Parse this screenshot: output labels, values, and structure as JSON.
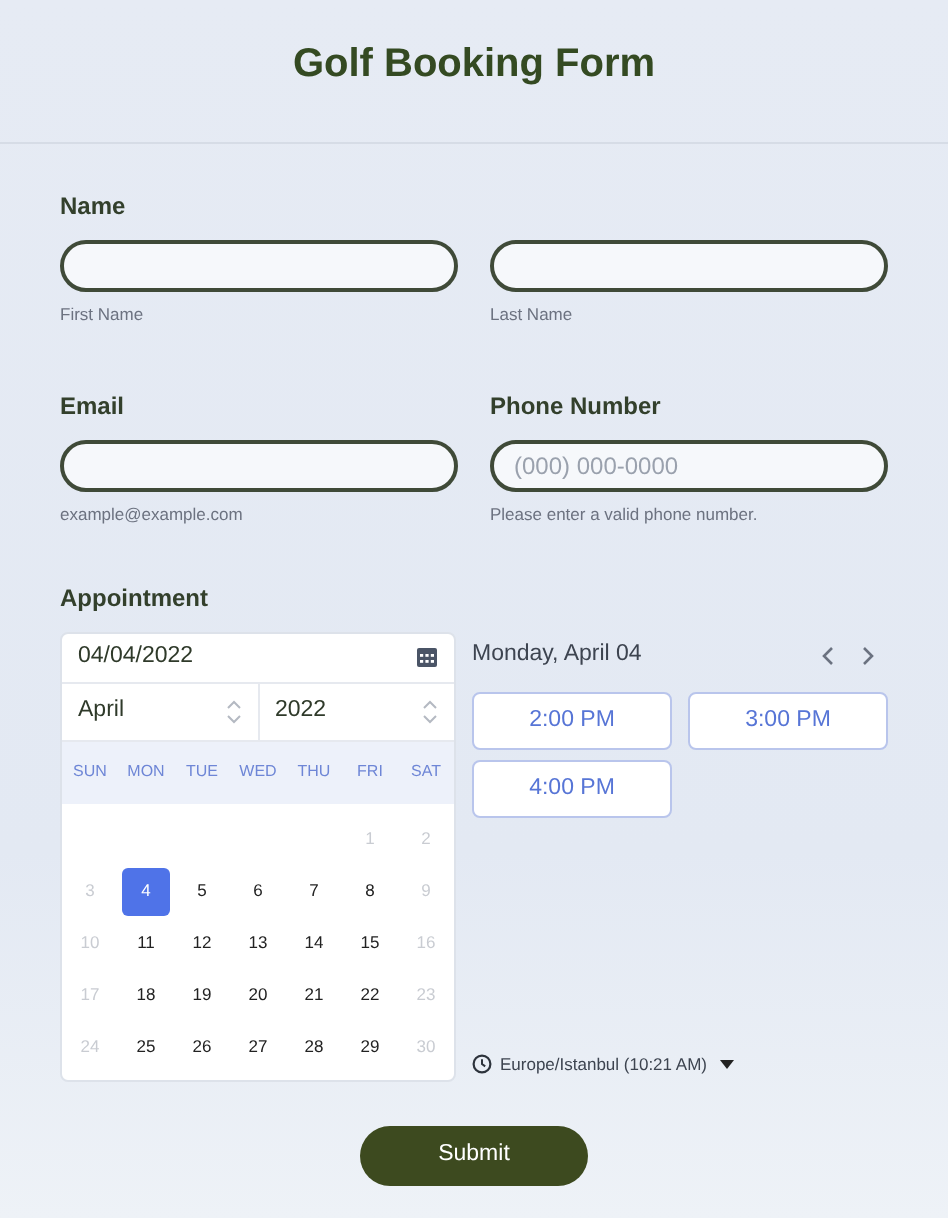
{
  "title": "Golf Booking Form",
  "name": {
    "label": "Name",
    "fields": [
      {
        "sublabel": "First Name"
      },
      {
        "sublabel": "Last Name"
      }
    ]
  },
  "email": {
    "label": "Email",
    "sublabel": "example@example.com"
  },
  "phone": {
    "label": "Phone Number",
    "placeholder": "(000) 000-0000",
    "sublabel": "Please enter a valid phone number."
  },
  "appointment": {
    "label": "Appointment",
    "date_value": "04/04/2022",
    "month": "April",
    "year": "2022",
    "weekdays": [
      "SUN",
      "MON",
      "TUE",
      "WED",
      "THU",
      "FRI",
      "SAT"
    ],
    "weeks": [
      [
        {
          "label": "1",
          "available": false,
          "selected": false
        },
        {
          "label": "2",
          "available": false,
          "selected": false
        }
      ],
      [
        {
          "label": "3",
          "available": false,
          "selected": false
        },
        {
          "label": "4",
          "available": true,
          "selected": true
        },
        {
          "label": "5",
          "available": true,
          "selected": false
        },
        {
          "label": "6",
          "available": true,
          "selected": false
        },
        {
          "label": "7",
          "available": true,
          "selected": false
        },
        {
          "label": "8",
          "available": true,
          "selected": false
        },
        {
          "label": "9",
          "available": false,
          "selected": false
        }
      ],
      [
        {
          "label": "10",
          "available": false,
          "selected": false
        },
        {
          "label": "11",
          "available": true,
          "selected": false
        },
        {
          "label": "12",
          "available": true,
          "selected": false
        },
        {
          "label": "13",
          "available": true,
          "selected": false
        },
        {
          "label": "14",
          "available": true,
          "selected": false
        },
        {
          "label": "15",
          "available": true,
          "selected": false
        },
        {
          "label": "16",
          "available": false,
          "selected": false
        }
      ],
      [
        {
          "label": "17",
          "available": false,
          "selected": false
        },
        {
          "label": "18",
          "available": true,
          "selected": false
        },
        {
          "label": "19",
          "available": true,
          "selected": false
        },
        {
          "label": "20",
          "available": true,
          "selected": false
        },
        {
          "label": "21",
          "available": true,
          "selected": false
        },
        {
          "label": "22",
          "available": true,
          "selected": false
        },
        {
          "label": "23",
          "available": false,
          "selected": false
        }
      ],
      [
        {
          "label": "24",
          "available": false,
          "selected": false
        },
        {
          "label": "25",
          "available": true,
          "selected": false
        },
        {
          "label": "26",
          "available": true,
          "selected": false
        },
        {
          "label": "27",
          "available": true,
          "selected": false
        },
        {
          "label": "28",
          "available": true,
          "selected": false
        },
        {
          "label": "29",
          "available": true,
          "selected": false
        },
        {
          "label": "30",
          "available": false,
          "selected": false
        }
      ]
    ],
    "day_heading": "Monday, April 04",
    "slots": [
      "2:00 PM",
      "3:00 PM",
      "4:00 PM"
    ],
    "timezone": "Europe/Istanbul (10:21 AM)"
  },
  "submit": "Submit"
}
